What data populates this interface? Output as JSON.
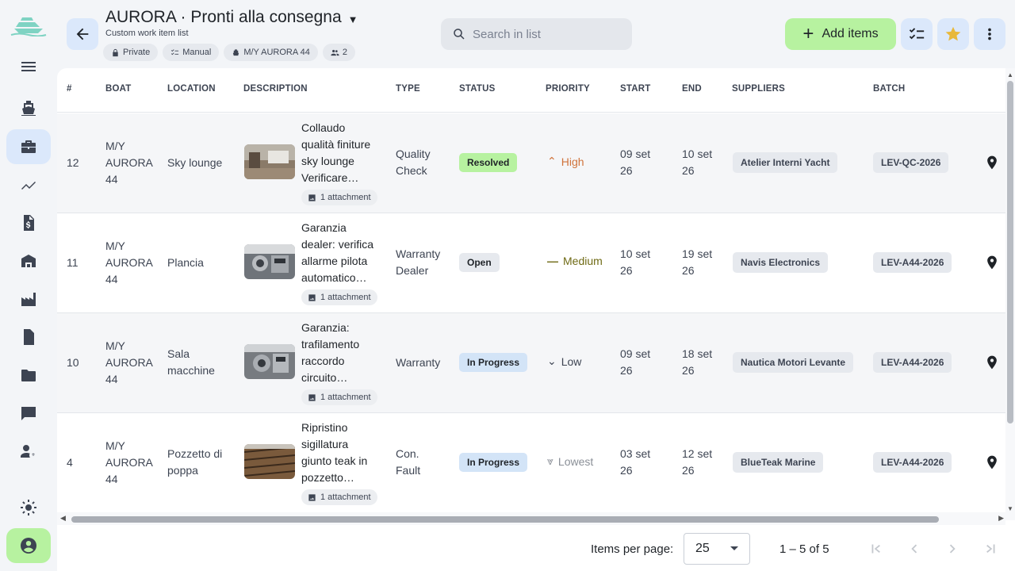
{
  "header": {
    "title": "AURORA · Pronti alla consegna",
    "subtitle": "Custom work item list",
    "chips": [
      {
        "icon": "lock-icon",
        "label": "Private"
      },
      {
        "icon": "checklist-icon",
        "label": "Manual"
      },
      {
        "icon": "boat-icon",
        "label": "M/Y AURORA 44"
      },
      {
        "icon": "people-icon",
        "label": "2"
      }
    ],
    "search_placeholder": "Search in list",
    "add_label": "Add items"
  },
  "table": {
    "columns": [
      "#",
      "BOAT",
      "LOCATION",
      "DESCRIPTION",
      "TYPE",
      "STATUS",
      "PRIORITY",
      "START",
      "END",
      "SUPPLIERS",
      "BATCH"
    ],
    "rows": [
      {
        "id": "12",
        "boat": [
          "M/Y",
          "AURORA",
          "44"
        ],
        "location": [
          "Sky lounge"
        ],
        "description": [
          "Collaudo",
          "qualità finiture",
          "sky lounge",
          "Verificare…"
        ],
        "attachment": "1 attachment",
        "type": [
          "Quality",
          "Check"
        ],
        "status": "Resolved",
        "priority": "High",
        "start": [
          "09 set",
          "26"
        ],
        "end": [
          "10 set",
          "26"
        ],
        "supplier": "Atelier Interni Yacht",
        "batch": "LEV-QC-2026"
      },
      {
        "id": "11",
        "boat": [
          "M/Y",
          "AURORA",
          "44"
        ],
        "location": [
          "Plancia"
        ],
        "description": [
          "Garanzia",
          "dealer: verifica",
          "allarme pilota",
          "automatico…"
        ],
        "attachment": "1 attachment",
        "type": [
          "Warranty",
          "Dealer"
        ],
        "status": "Open",
        "priority": "Medium",
        "start": [
          "10 set",
          "26"
        ],
        "end": [
          "19 set",
          "26"
        ],
        "supplier": "Navis Electronics",
        "batch": "LEV-A44-2026"
      },
      {
        "id": "10",
        "boat": [
          "M/Y",
          "AURORA",
          "44"
        ],
        "location": [
          "Sala",
          "macchine"
        ],
        "description": [
          "Garanzia:",
          "trafilamento",
          "raccordo",
          "circuito…"
        ],
        "attachment": "1 attachment",
        "type": [
          "Warranty"
        ],
        "status": "In Progress",
        "priority": "Low",
        "start": [
          "09 set",
          "26"
        ],
        "end": [
          "18 set",
          "26"
        ],
        "supplier": "Nautica Motori Levante",
        "batch": "LEV-A44-2026"
      },
      {
        "id": "4",
        "boat": [
          "M/Y",
          "AURORA",
          "44"
        ],
        "location": [
          "Pozzetto di",
          "poppa"
        ],
        "description": [
          "Ripristino",
          "sigillatura",
          "giunto teak in",
          "pozzetto…"
        ],
        "attachment": "1 attachment",
        "type": [
          "Con.",
          "Fault"
        ],
        "status": "In Progress",
        "priority": "Lowest",
        "start": [
          "03 set",
          "26"
        ],
        "end": [
          "12 set",
          "26"
        ],
        "supplier": "BlueTeak Marine",
        "batch": "LEV-A44-2026"
      }
    ]
  },
  "colors": {
    "resolved": "#b7f2a0",
    "open": "#e6e9ee",
    "in_progress": "#d3e4f7",
    "high": "#d0733b",
    "medium": "#6f6a14",
    "low": "#3d4452",
    "lowest": "#8a8f97",
    "accent_green": "#b7f2a0",
    "accent_blue": "#dbe8fb"
  },
  "pager": {
    "label": "Items per page:",
    "page_size": "25",
    "range": "1 – 5 of 5"
  }
}
